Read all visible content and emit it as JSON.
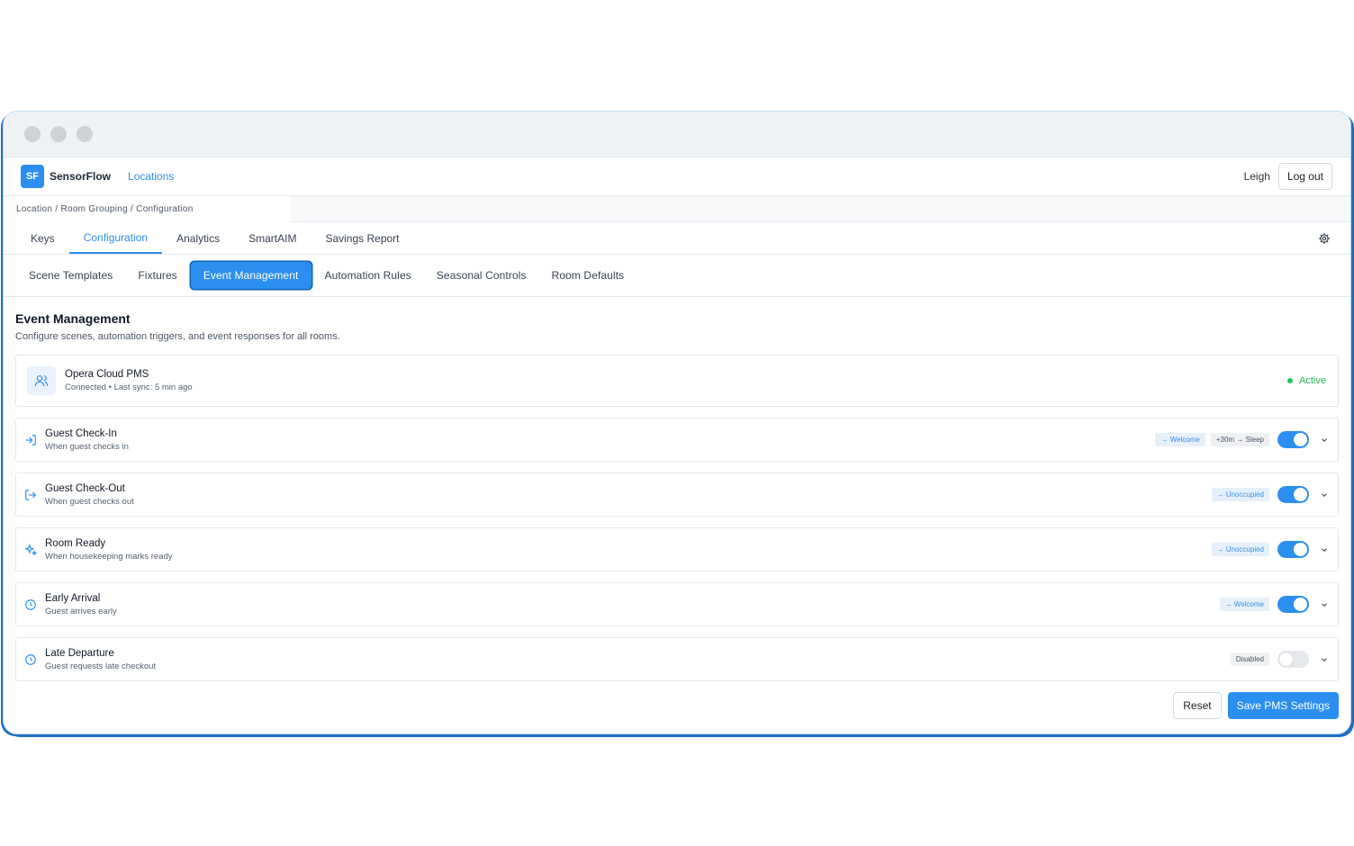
{
  "app": {
    "logo_text": "SF",
    "brand": "SensorFlow",
    "nav_link": "Locations",
    "user": "Leigh",
    "logout": "Log out"
  },
  "breadcrumb": "Location / Room Grouping / Configuration",
  "tabs": [
    {
      "label": "Keys",
      "active": false
    },
    {
      "label": "Configuration",
      "active": true
    },
    {
      "label": "Analytics",
      "active": false
    },
    {
      "label": "SmartAIM",
      "active": false
    },
    {
      "label": "Savings Report",
      "active": false
    }
  ],
  "subtabs": [
    {
      "label": "Scene Templates",
      "active": false
    },
    {
      "label": "Fixtures",
      "active": false
    },
    {
      "label": "Event Management",
      "active": true
    },
    {
      "label": "Automation Rules",
      "active": false
    },
    {
      "label": "Seasonal Controls",
      "active": false
    },
    {
      "label": "Room Defaults",
      "active": false
    }
  ],
  "page": {
    "title": "Event Management",
    "description": "Configure scenes, automation triggers, and event responses for all rooms."
  },
  "pms": {
    "name": "Opera Cloud PMS",
    "status_line": "Connected • Last sync: 5 min ago",
    "status": "Active",
    "icon": "users-icon"
  },
  "events": [
    {
      "title": "Guest Check-In",
      "subtitle": "When guest checks in",
      "icon": "login-icon",
      "tags": [
        {
          "text": "→ Welcome",
          "style": "blue"
        },
        {
          "text": "+30m → Sleep",
          "style": "gray"
        }
      ],
      "enabled": true
    },
    {
      "title": "Guest Check-Out",
      "subtitle": "When guest checks out",
      "icon": "logout-icon",
      "tags": [
        {
          "text": "→ Unoccupied",
          "style": "blue"
        }
      ],
      "enabled": true
    },
    {
      "title": "Room Ready",
      "subtitle": "When housekeeping marks ready",
      "icon": "sparkle-icon",
      "tags": [
        {
          "text": "→ Unoccupied",
          "style": "blue"
        }
      ],
      "enabled": true
    },
    {
      "title": "Early Arrival",
      "subtitle": "Guest arrives early",
      "icon": "clock-icon",
      "tags": [
        {
          "text": "→ Welcome",
          "style": "blue"
        }
      ],
      "enabled": true
    },
    {
      "title": "Late Departure",
      "subtitle": "Guest requests late checkout",
      "icon": "clock-icon",
      "tags": [
        {
          "text": "Disabled",
          "style": "gray"
        }
      ],
      "enabled": false
    }
  ],
  "buttons": {
    "reset": "Reset",
    "save": "Save PMS Settings"
  },
  "colors": {
    "accent": "#2b8ff0",
    "success": "#22c55e"
  }
}
